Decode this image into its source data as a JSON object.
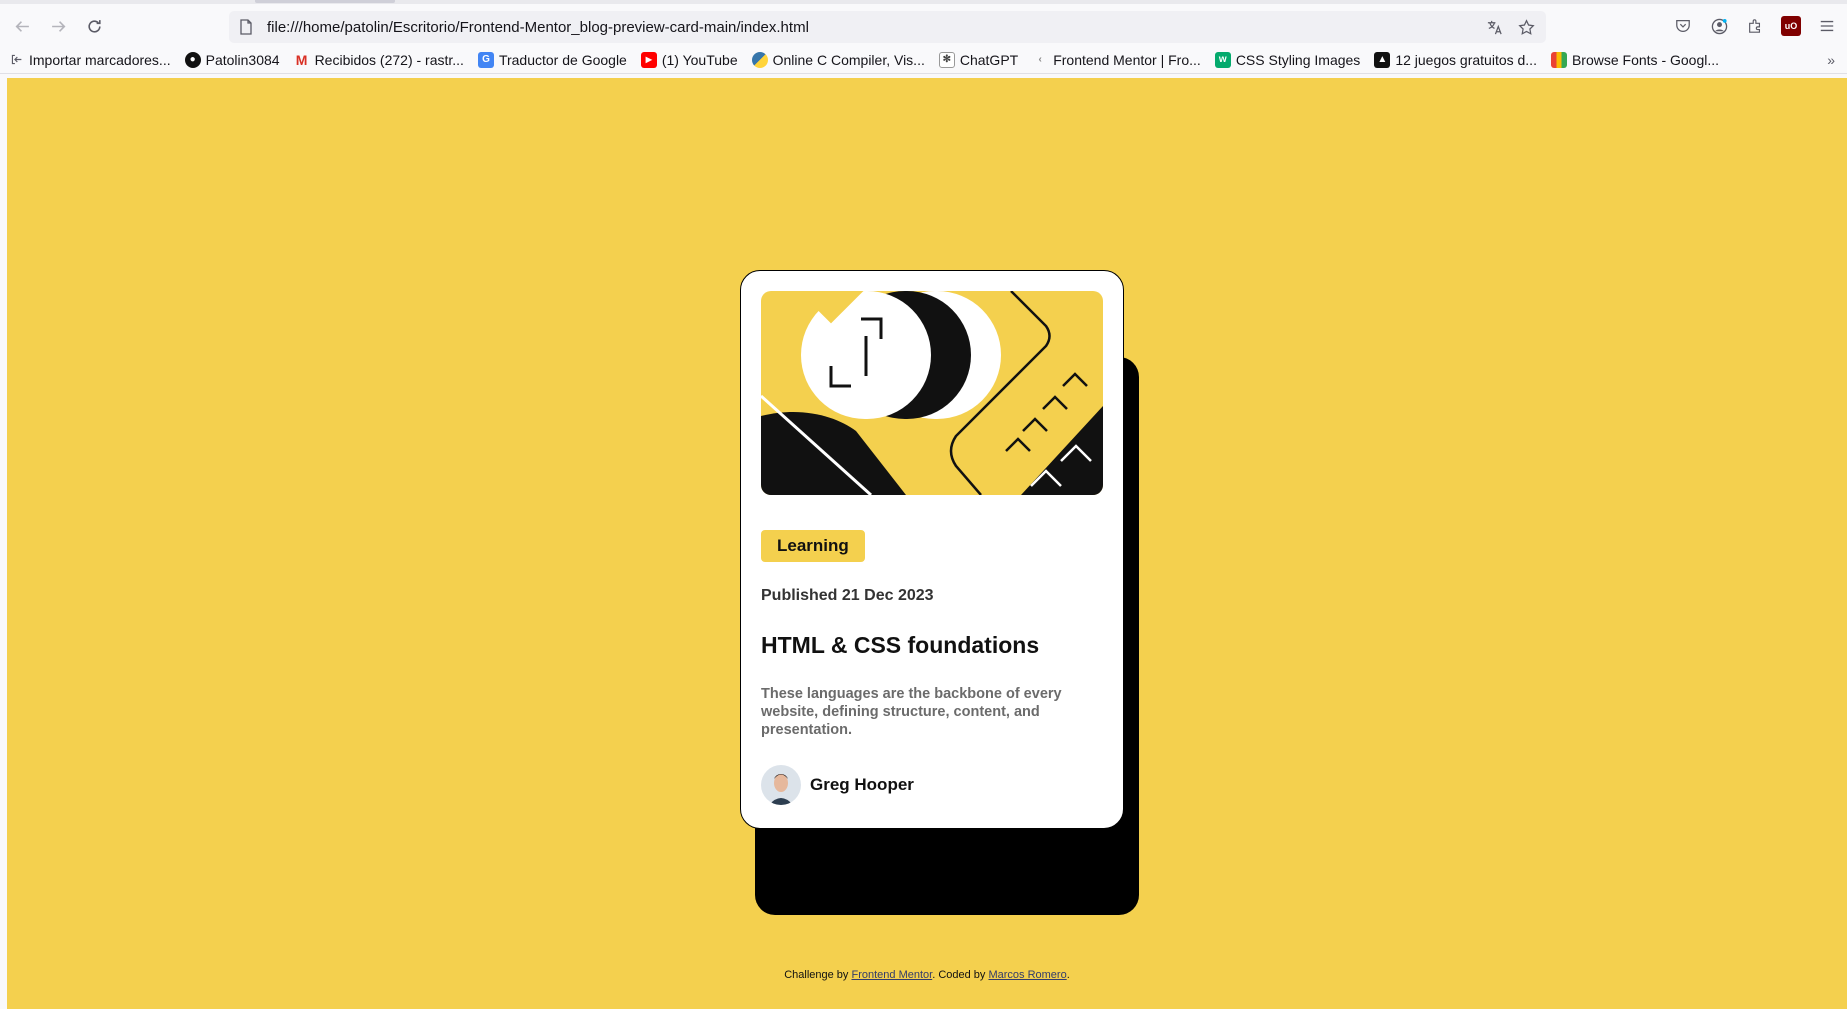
{
  "browser": {
    "url": "file:///home/patolin/Escritorio/Frontend-Mentor_blog-preview-card-main/index.html",
    "bookmarks": [
      {
        "label": "Importar marcadores...",
        "icon": "import-icon"
      },
      {
        "label": "Patolin3084",
        "icon": "github-icon"
      },
      {
        "label": "Recibidos (272) - rastr...",
        "icon": "gmail-icon"
      },
      {
        "label": "Traductor de Google",
        "icon": "google-translate-icon"
      },
      {
        "label": "(1) YouTube",
        "icon": "youtube-icon"
      },
      {
        "label": "Online C Compiler, Vis...",
        "icon": "python-icon"
      },
      {
        "label": "ChatGPT",
        "icon": "chatgpt-icon"
      },
      {
        "label": "Frontend Mentor | Fro...",
        "icon": "frontend-mentor-icon"
      },
      {
        "label": "CSS Styling Images",
        "icon": "w3schools-icon"
      },
      {
        "label": "12 juegos gratuitos d...",
        "icon": "game-icon"
      },
      {
        "label": "Browse Fonts - Googl...",
        "icon": "google-fonts-icon"
      }
    ]
  },
  "colors": {
    "page_background": "#f4d04e",
    "card_background": "#ffffff",
    "tag_background": "#f4d04e",
    "shadow": "#000000"
  },
  "card": {
    "tag": "Learning",
    "published": "Published 21 Dec 2023",
    "title": "HTML & CSS foundations",
    "excerpt": "These languages are the backbone of every website, defining structure, content, and presentation.",
    "author": "Greg Hooper"
  },
  "attribution": {
    "prefix": "Challenge by ",
    "link1": "Frontend Mentor",
    "middle": ". Coded by ",
    "link2": "Marcos Romero",
    "suffix": "."
  }
}
